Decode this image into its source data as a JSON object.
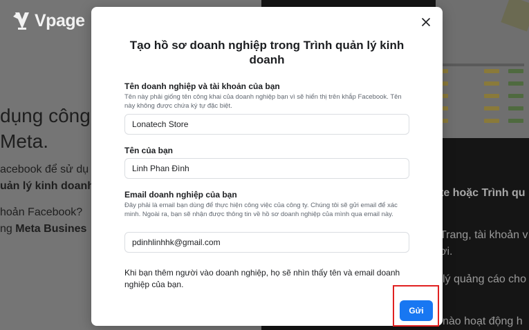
{
  "background": {
    "brand": "Vpage",
    "hero_line1": "dụng công",
    "hero_line2": "Meta.",
    "para_line1": "acebook để sử dụ",
    "para_line2": "uản lý kinh doanh",
    "para_line3": "hoản Facebook? ",
    "para_line4_prefix": "ng ",
    "para_line4_bold": "Meta Busines",
    "right_heading": "te hoặc Trình qu",
    "right_line1": "Trang, tài khoản v",
    "right_line2": "ơi.",
    "right_line3": "lý quảng cáo cho",
    "right_line4": "nào hoạt động h"
  },
  "modal": {
    "title": "Tạo hồ sơ doanh nghiệp trong Trình quản lý kinh doanh",
    "close_label": "✕",
    "business_name": {
      "label": "Tên doanh nghiệp và tài khoản của bạn",
      "help": "Tên này phải giống tên công khai của doanh nghiệp bạn vì sẽ hiển thị trên khắp Facebook. Tên này không được chứa ký tự đặc biệt.",
      "value": "Lonatech Store"
    },
    "your_name": {
      "label": "Tên của bạn",
      "value": "Linh Phan Đình"
    },
    "business_email": {
      "label": "Email doanh nghiệp của bạn",
      "help": "Đây phải là email bạn dùng để thực hiện công việc của công ty. Chúng tôi sẽ gửi email để xác minh. Ngoài ra, bạn sẽ nhận được thông tin về hồ sơ doanh nghiệp của mình qua email này.",
      "value": "pdinhlinhhk@gmail.com"
    },
    "footer_note": "Khi bạn thêm người vào doanh nghiệp, họ sẽ nhìn thấy tên và email doanh nghiệp của bạn.",
    "submit_label": "Gửi"
  },
  "colors": {
    "accent": "#1877f2",
    "highlight": "#e02020"
  }
}
